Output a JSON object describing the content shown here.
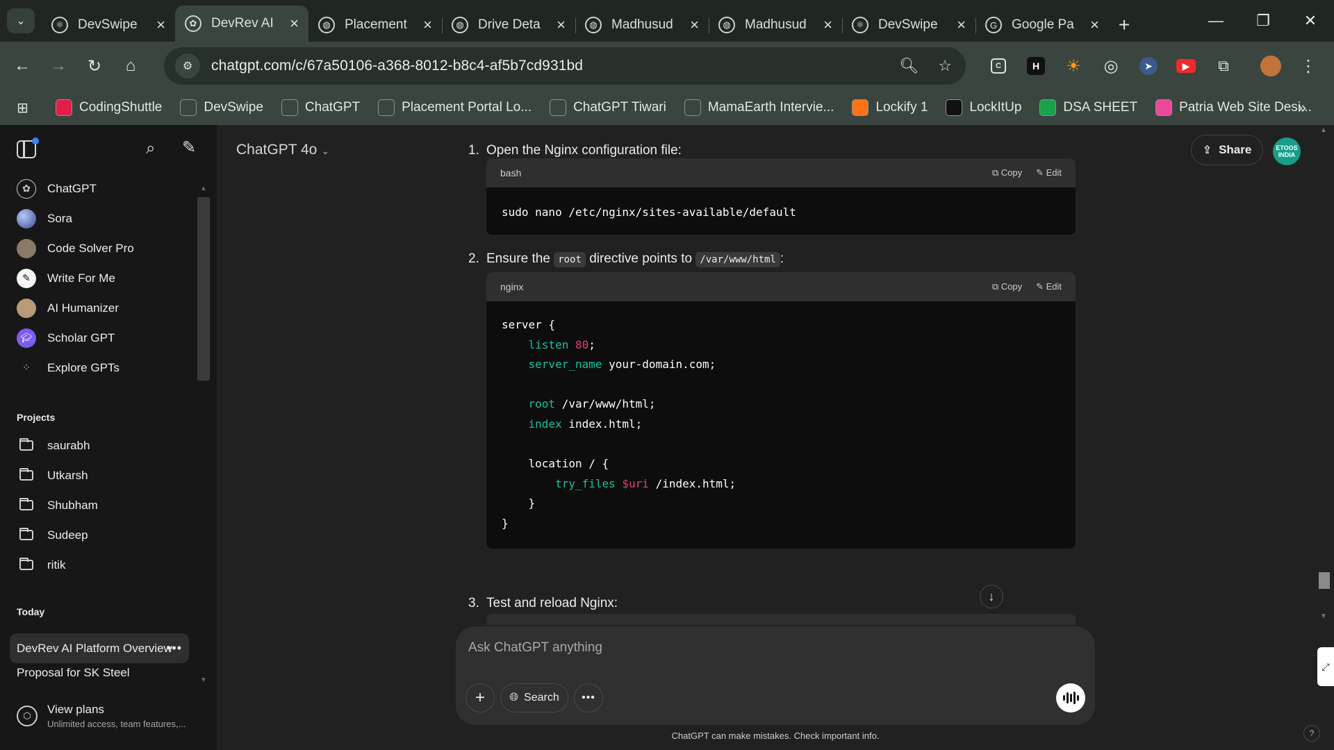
{
  "browser": {
    "tabs": [
      {
        "label": "DevSwipe",
        "icon": "react-icon",
        "active": false
      },
      {
        "label": "DevRev AI",
        "icon": "openai-icon",
        "active": true
      },
      {
        "label": "Placement",
        "icon": "globe-icon",
        "active": false
      },
      {
        "label": "Drive Deta",
        "icon": "globe-icon",
        "active": false
      },
      {
        "label": "Madhusud",
        "icon": "globe-icon",
        "active": false
      },
      {
        "label": "Madhusud",
        "icon": "globe-icon",
        "active": false
      },
      {
        "label": "DevSwipe",
        "icon": "react-icon",
        "active": false
      },
      {
        "label": "Google Pa",
        "icon": "google-pay-icon",
        "active": false
      }
    ],
    "url": "chatgpt.com/c/67a50106-a368-8012-b8c4-af5b7cd931bd",
    "bookmarks": [
      {
        "label": "CodingShuttle",
        "color": "#e11d48"
      },
      {
        "label": "DevSwipe",
        "color": "#3b4540"
      },
      {
        "label": "ChatGPT",
        "color": "#3b4540"
      },
      {
        "label": "Placement Portal Lo...",
        "color": "#3b4540"
      },
      {
        "label": "ChatGPT Tiwari",
        "color": "#3b4540"
      },
      {
        "label": "MamaEarth Intervie...",
        "color": "#3b4540"
      },
      {
        "label": "Lockify 1",
        "color": "#f97316"
      },
      {
        "label": "LockItUp",
        "color": "#111111"
      },
      {
        "label": "DSA SHEET",
        "color": "#16a34a"
      },
      {
        "label": "Patria Web Site Desi...",
        "color": "#ec4899"
      }
    ]
  },
  "sidebar": {
    "gpts": [
      {
        "label": "ChatGPT",
        "icon": "openai-icon"
      },
      {
        "label": "Sora",
        "icon": "sora-icon"
      },
      {
        "label": "Code Solver Pro",
        "icon": "code-solver-icon"
      },
      {
        "label": "Write For Me",
        "icon": "pen-icon"
      },
      {
        "label": "AI Humanizer",
        "icon": "humanizer-icon"
      },
      {
        "label": "Scholar GPT",
        "icon": "scholar-icon"
      },
      {
        "label": "Explore GPTs",
        "icon": "grid-icon"
      }
    ],
    "projects_heading": "Projects",
    "projects": [
      "saurabh",
      "Utkarsh",
      "Shubham",
      "Sudeep",
      "ritik"
    ],
    "today_heading": "Today",
    "chats": [
      {
        "label": "DevRev AI Platform Overview",
        "active": true
      },
      {
        "label": "Proposal for SK Steel",
        "active": false
      }
    ],
    "view_plans": {
      "title": "View plans",
      "subtitle": "Unlimited access, team features,..."
    }
  },
  "header": {
    "model": "ChatGPT 4o",
    "share_label": "Share",
    "avatar_text": "ETOOS INDIA"
  },
  "conversation": {
    "step1": {
      "num": "1.",
      "text": "Open the Nginx configuration file:"
    },
    "block1": {
      "lang": "bash",
      "copy": "Copy",
      "edit": "Edit",
      "code": "sudo nano /etc/nginx/sites-available/default"
    },
    "step2": {
      "num": "2.",
      "pre": "Ensure the",
      "code1": "root",
      "mid": "directive points to",
      "code2": "/var/www/html",
      "post": ":"
    },
    "block2": {
      "lang": "nginx",
      "copy": "Copy",
      "edit": "Edit",
      "lines": [
        {
          "t": "server {"
        },
        {
          "t": "    ",
          "kw": "listen",
          "n": " 80",
          "rest": ";"
        },
        {
          "t": "    ",
          "kw": "server_name",
          "rest": " your-domain.com;"
        },
        {
          "t": ""
        },
        {
          "t": "    ",
          "kw": "root",
          "rest": " /var/www/html;"
        },
        {
          "t": "    ",
          "kw": "index",
          "rest": " index.html;"
        },
        {
          "t": ""
        },
        {
          "t": "    location / {"
        },
        {
          "t": "        ",
          "kw": "try_files",
          "v": " $uri",
          "rest": " /index.html;"
        },
        {
          "t": "    }"
        },
        {
          "t": "}"
        }
      ]
    },
    "step3": {
      "num": "3.",
      "text": "Test and reload Nginx:"
    }
  },
  "composer": {
    "placeholder": "Ask ChatGPT anything",
    "search_label": "Search"
  },
  "disclaimer": "ChatGPT can make mistakes. Check important info."
}
